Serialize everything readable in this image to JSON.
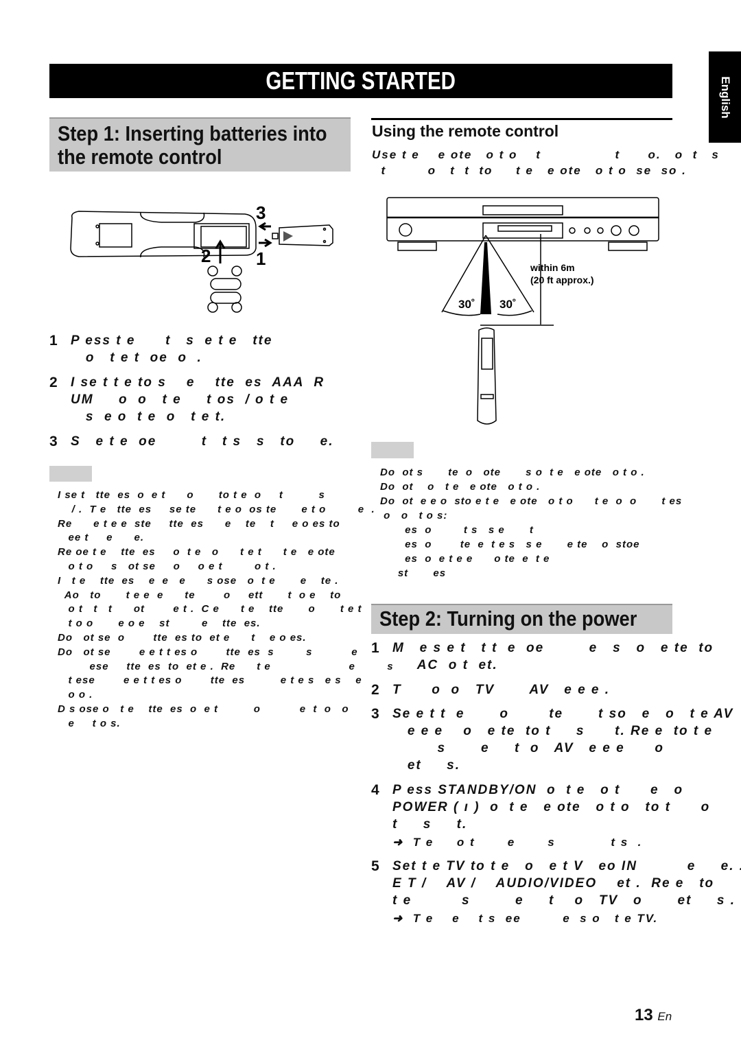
{
  "header": {
    "title": "GETTING STARTED",
    "language_tab": "English"
  },
  "step1": {
    "title_lines": [
      "Step 1: Inserting batteries into",
      "the remote control"
    ],
    "figure": {
      "labels": [
        "3",
        "2",
        "1"
      ]
    },
    "steps": [
      {
        "num": "1",
        "lines": [
          "P ess t e      t   s  e t e   tte",
          "   o   t e t  oe  o  ."
        ]
      },
      {
        "num": "2",
        "lines": [
          "I se t t e to s    e    tte  es  AAA  R",
          "UM     o  o   t e     t os  / o t e",
          "   s  e o  t e  o   t e t."
        ]
      },
      {
        "num": "3",
        "lines": [
          "S   e t e  oe         t   t s   s   to     e."
        ]
      }
    ],
    "notes": [
      "I se t   tte  es  o  e t      o       to t e  o     t          s",
      "    / .  T e   tte  es     se te      t e o  os te       e t o         e  .",
      "Re      e t e e  ste     tte  es      e    te    t     e o es to",
      "   ee t     e      e.",
      "Re oe t e    tte  es     o  t e   o      t e t      t e   e ote",
      "   o t o     s   ot se     o     o e t         o t .",
      "I   t e    tte  es    e  e   e      s ose   o  t e       e    te .",
      "  Ao   to       t e e  e      te        o     ett       t  o e    to",
      "   o t   t   t      ot        e t .  C e      t e    tte       o       t e t",
      "   t o o       e o e    st         e    tte  es.",
      "Do   ot se  o        tte  es to  et e      t    e o es.",
      "Do   ot se        e e t t es o        tte  es  s         s           e",
      "         ese     tte  es  to  et e .  Re      t e                      e         s",
      "   t ese        e e t t es o        tte  es          e t e s   e s    e",
      "   o o .",
      "D s ose o   t e    tte  es  o  e t          o           e  t  o   o",
      "   e     t o s."
    ]
  },
  "remote": {
    "heading": "Using the remote control",
    "intro_lines": [
      "Use t e    e ote   o t o    t                t      o.   o  t   s",
      "  t         o   t  t  to     t e   e ote   o t o  se  so ."
    ],
    "figure": {
      "distance": "within 6m",
      "distance_approx": "(20 ft approx.)",
      "angle_left": "30˚",
      "angle_right": "30˚"
    },
    "notes": [
      "Do  ot s       te  o   ote       s o  t e   e ote   o t o .",
      "Do  ot    o   t e   e ote   o t o .",
      "Do  ot  e e o  sto e t e   e ote   o t o      t e  o  o       t es",
      " o   o   t o s:",
      "       es  o         t s   s e       t",
      "       es  o        te  e  t e s   s e       e te    o  stoe",
      "       es  o  e t e e      o te  e  t e",
      "     st       es"
    ]
  },
  "step2": {
    "title": "Step 2: Turning on the power",
    "steps": [
      {
        "num": "1",
        "lines": [
          "M   e s e t   t t  e  oe         e   s   o   e te  to",
          "     AC  o t  et."
        ]
      },
      {
        "num": "2",
        "lines": [
          "T      o  o   TV       AV   e e e ."
        ]
      },
      {
        "num": "3",
        "lines": [
          "Se e t t  e       o        te       t so   e   o   t e AV",
          "   e e e    o   e te  to t     s      t. Re e  to t e",
          "         s       e     t  o   AV   e e e      o",
          "   et     s."
        ]
      },
      {
        "num": "4",
        "lines": [
          "P ess STANDBY/ON  o  t e   o t      e   o",
          "POWER ( ı )  o  t e   e ote   o t o   to t      o",
          "t     s     t."
        ]
      },
      {
        "num": "5",
        "lines": [
          "Set t e TV to t e   o   e t V   eo IN          e     e. .",
          "E T /    AV /    AUDIO/VIDEO    et .  Re e   to",
          "t e          s         e     t    o   TV   o       et     s ."
        ]
      }
    ],
    "results": [
      {
        "after": "4",
        "text": "➜  T e     o t       e       s            t s  ."
      },
      {
        "after": "5",
        "text": "➜  T e    e    t s  ee         e  s o   t e TV."
      }
    ]
  },
  "footer": {
    "page_number": "13",
    "page_suffix": "En"
  }
}
